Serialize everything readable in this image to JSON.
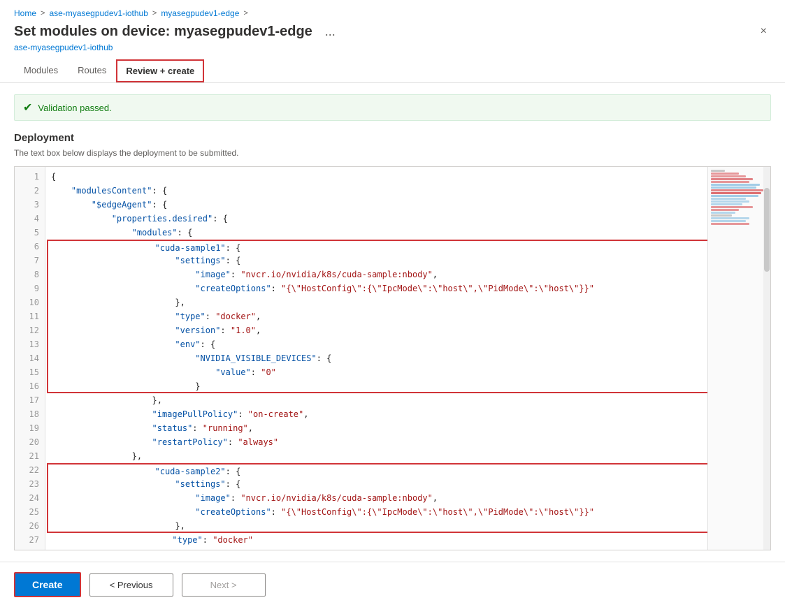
{
  "breadcrumb": {
    "items": [
      "Home",
      "ase-myasegpudev1-iothub",
      "myasegpudev1-edge"
    ],
    "separators": [
      ">",
      ">",
      ">"
    ]
  },
  "header": {
    "title": "Set modules on device: myasegpudev1-edge",
    "subtitle": "ase-myasegpudev1-iothub",
    "dots_label": "...",
    "close_label": "×"
  },
  "tabs": [
    {
      "label": "Modules",
      "active": false
    },
    {
      "label": "Routes",
      "active": false
    },
    {
      "label": "Review + create",
      "active": true
    }
  ],
  "validation": {
    "text": "Validation passed."
  },
  "deployment": {
    "title": "Deployment",
    "description": "The text box below displays the deployment to be submitted."
  },
  "code": {
    "lines": [
      {
        "num": 1,
        "text": "{"
      },
      {
        "num": 2,
        "text": "    \"modulesContent\": {"
      },
      {
        "num": 3,
        "text": "        \"$edgeAgent\": {"
      },
      {
        "num": 4,
        "text": "            \"properties.desired\": {"
      },
      {
        "num": 5,
        "text": "                \"modules\": {"
      },
      {
        "num": 6,
        "text": "                    \"cuda-sample1\": {"
      },
      {
        "num": 7,
        "text": "                        \"settings\": {"
      },
      {
        "num": 8,
        "text": "                            \"image\": \"nvcr.io/nvidia/k8s/cuda-sample:nbody\","
      },
      {
        "num": 9,
        "text": "                            \"createOptions\": \"{\\\"HostConfig\\\":{\\\"IpcMode\\\":\\\"host\\\",\\\"PidMode\\\":\\\"host\\\"}}\""
      },
      {
        "num": 10,
        "text": "                        },"
      },
      {
        "num": 11,
        "text": "                        \"type\": \"docker\","
      },
      {
        "num": 12,
        "text": "                        \"version\": \"1.0\","
      },
      {
        "num": 13,
        "text": "                        \"env\": {"
      },
      {
        "num": 14,
        "text": "                            \"NVIDIA_VISIBLE_DEVICES\": {"
      },
      {
        "num": 15,
        "text": "                                \"value\": \"0\""
      },
      {
        "num": 16,
        "text": "                            }"
      },
      {
        "num": 17,
        "text": "                    },"
      },
      {
        "num": 18,
        "text": "                    \"imagePullPolicy\": \"on-create\","
      },
      {
        "num": 19,
        "text": "                    \"status\": \"running\","
      },
      {
        "num": 20,
        "text": "                    \"restartPolicy\": \"always\""
      },
      {
        "num": 21,
        "text": "                },"
      },
      {
        "num": 22,
        "text": "                    \"cuda-sample2\": {"
      },
      {
        "num": 23,
        "text": "                        \"settings\": {"
      },
      {
        "num": 24,
        "text": "                            \"image\": \"nvcr.io/nvidia/k8s/cuda-sample:nbody\","
      },
      {
        "num": 25,
        "text": "                            \"createOptions\": \"{\\\"HostConfig\\\":{\\\"IpcMode\\\":\\\"host\\\",\\\"PidMode\\\":\\\"host\\\"}}\""
      },
      {
        "num": 26,
        "text": "                        },"
      },
      {
        "num": 27,
        "text": "                        \"type\": \"docker\""
      }
    ]
  },
  "buttons": {
    "create": "Create",
    "previous": "< Previous",
    "next": "Next >"
  }
}
